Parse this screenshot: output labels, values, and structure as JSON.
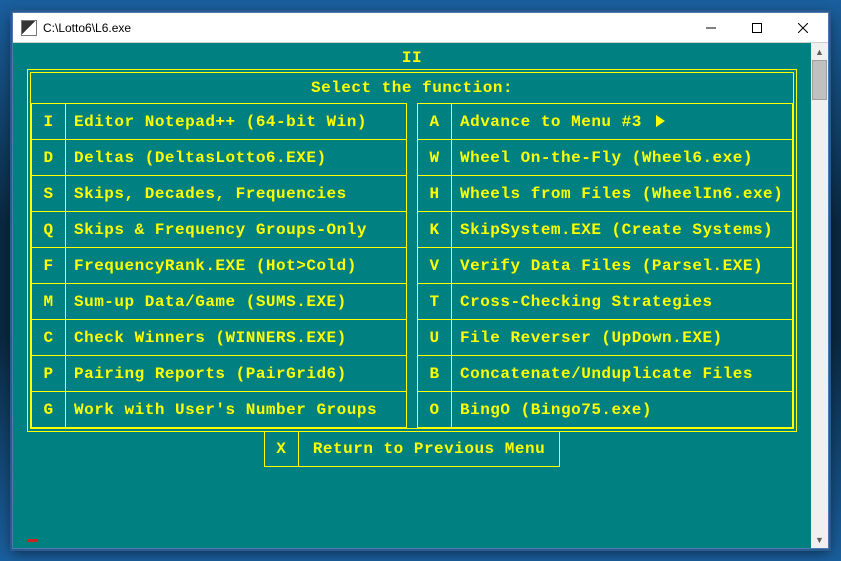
{
  "window": {
    "title": "C:\\Lotto6\\L6.exe"
  },
  "page_number": "II",
  "header": "Select the function:",
  "left_items": [
    {
      "key": "I",
      "label": "Editor Notepad++ (64-bit Win)"
    },
    {
      "key": "D",
      "label": "Deltas (DeltasLotto6.EXE)"
    },
    {
      "key": "S",
      "label": "Skips, Decades, Frequencies"
    },
    {
      "key": "Q",
      "label": "Skips & Frequency Groups-Only"
    },
    {
      "key": "F",
      "label": "FrequencyRank.EXE (Hot>Cold)"
    },
    {
      "key": "M",
      "label": "Sum-up Data/Game (SUMS.EXE)"
    },
    {
      "key": "C",
      "label": "Check Winners (WINNERS.EXE)"
    },
    {
      "key": "P",
      "label": "Pairing Reports (PairGrid6)"
    },
    {
      "key": "G",
      "label": "Work with User's Number Groups"
    }
  ],
  "right_items": [
    {
      "key": "A",
      "label": "Advance to Menu #3 ",
      "arrow": true
    },
    {
      "key": "W",
      "label": "Wheel On-the-Fly (Wheel6.exe)"
    },
    {
      "key": "H",
      "label": "Wheels from Files (WheelIn6.exe)"
    },
    {
      "key": "K",
      "label": "SkipSystem.EXE (Create Systems)"
    },
    {
      "key": "V",
      "label": "Verify Data Files (Parsel.EXE)"
    },
    {
      "key": "T",
      "label": "Cross-Checking Strategies"
    },
    {
      "key": "U",
      "label": "File Reverser (UpDown.EXE)"
    },
    {
      "key": "B",
      "label": "Concatenate/Unduplicate Files"
    },
    {
      "key": "O",
      "label": "BingO (Bingo75.exe)"
    }
  ],
  "footer": {
    "key": "X",
    "label": "Return to Previous Menu"
  }
}
